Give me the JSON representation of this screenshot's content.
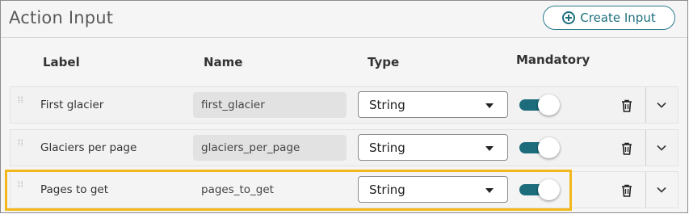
{
  "header": {
    "title": "Action Input",
    "create_label": "Create Input"
  },
  "columns": {
    "label": "Label",
    "name": "Name",
    "type": "Type",
    "mandatory": "Mandatory"
  },
  "rows": [
    {
      "label": "First glacier",
      "name": "first_glacier",
      "type": "String",
      "mandatory": true
    },
    {
      "label": "Glaciers per page",
      "name": "glaciers_per_page",
      "type": "String",
      "mandatory": true
    },
    {
      "label": "Pages to get",
      "name": "pages_to_get",
      "type": "String",
      "mandatory": true
    }
  ],
  "icons": {
    "create": "plus-circle-icon",
    "drag": "drag-handle-icon",
    "delete": "trash-icon",
    "expand": "chevron-down-icon",
    "dropdown": "caret-down-icon"
  },
  "colors": {
    "accent": "#1c6c7c",
    "highlight": "#f2b81b"
  }
}
